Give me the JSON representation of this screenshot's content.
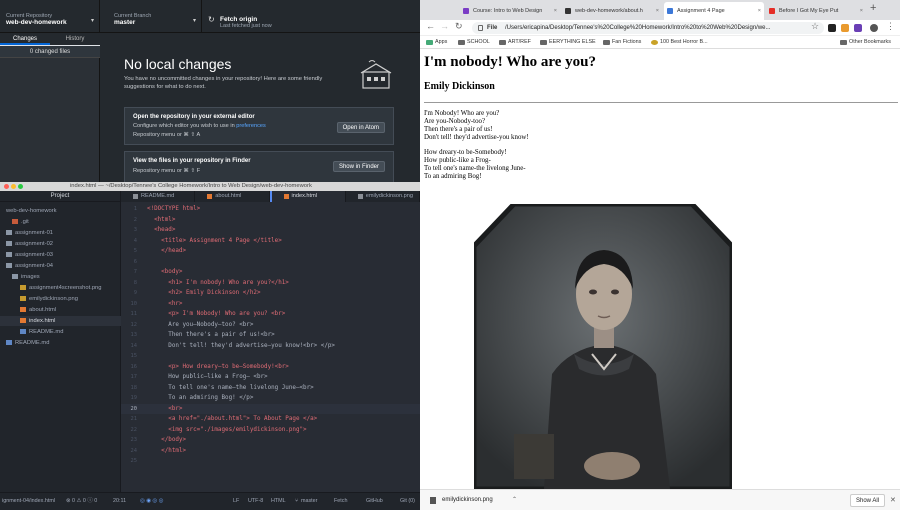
{
  "github": {
    "repo_caption": "Current Repository",
    "repo_name": "web-dev-homework",
    "branch_caption": "Current Branch",
    "branch_name": "master",
    "fetch_title": "Fetch origin",
    "fetch_sub": "Last fetched just now",
    "tabs": [
      "Changes",
      "History"
    ],
    "changed_count": "0 changed files",
    "empty_title": "No local changes",
    "empty_text": "You have no uncommitted changes in your repository! Here are some friendly suggestions for what to do next.",
    "card1_title": "Open the repository in your external editor",
    "card1_text_a": "Configure which editor you wish to use in ",
    "card1_link": "preferences",
    "card1_hint": "Repository menu or  ⌘  ⇧  A",
    "card1_button": "Open in Atom",
    "card2_title": "View the files in your repository in Finder",
    "card2_hint": "Repository menu or  ⌘  ⇧  F",
    "card2_button": "Show in Finder"
  },
  "atom": {
    "window_title": "index.html — ~/Desktop/Tennee's College Homework/Intro to Web Design/web-dev-homework",
    "tree_header": "Project",
    "tree": [
      {
        "label": "web-dev-homework",
        "kind": "root"
      },
      {
        "label": ".git",
        "kind": "git"
      },
      {
        "label": "assignment-01",
        "kind": "folder"
      },
      {
        "label": "assignment-02",
        "kind": "folder"
      },
      {
        "label": "assignment-03",
        "kind": "folder"
      },
      {
        "label": "assignment-04",
        "kind": "folder-open"
      },
      {
        "label": "images",
        "kind": "folder-open"
      },
      {
        "label": "assignment4screenshot.png",
        "kind": "image"
      },
      {
        "label": "emilydickinson.png",
        "kind": "image"
      },
      {
        "label": "about.html",
        "kind": "html"
      },
      {
        "label": "index.html",
        "kind": "html-selected"
      },
      {
        "label": "README.md",
        "kind": "md"
      },
      {
        "label": "README.md",
        "kind": "md"
      }
    ],
    "tabs": [
      "README.md",
      "about.html",
      "index.html",
      "emilydickinson.png"
    ],
    "code": [
      "<!DOCTYPE html>",
      "  <html>",
      "  <head>",
      "    <title> Assignment 4 Page </title>",
      "    </head>",
      "",
      "    <body>",
      "      <h1> I'm nobody! Who are you?</h1>",
      "      <h2> Emily Dickinson </h2>",
      "      <hr>",
      "      <p> I'm Nobody! Who are you? <br>",
      "      Are you—Nobody—too? <br>",
      "      Then there's a pair of us!<br>",
      "      Don't tell! they'd advertise—you know!<br> </p>",
      "",
      "      <p> How dreary—to be—Somebody!<br>",
      "      How public—like a Frog— <br>",
      "      To tell one's name—the livelong June—<br>",
      "      To an admiring Bog! </p>",
      "      <br>",
      "      <a href=\"./about.html\"> To About Page </a>",
      "      <img src=\"./images/emilydickinson.png\">",
      "    </body>",
      "    </html>",
      ""
    ],
    "current_line": 20,
    "status": {
      "path": "ignment-04/index.html",
      "problems": "⊗ 0  ⚠ 0  ⓘ 0",
      "cursor": "20:11",
      "eol": "LF",
      "encoding": "UTF-8",
      "grammar": "HTML",
      "branch": "master",
      "fetch": "Fetch",
      "github": "GitHub",
      "git": "Git (0)"
    }
  },
  "chrome": {
    "tabs": [
      {
        "title": "Course: Intro to Web Design",
        "color": "#7a3cc5"
      },
      {
        "title": "web-dev-homework/about.h",
        "color": "#333333"
      },
      {
        "title": "Assignment 4 Page",
        "color": "#3c78d8"
      },
      {
        "title": "Before I Got My Eye Put",
        "color": "#e52d27"
      }
    ],
    "url_label": "File",
    "url": "/Users/ericapina/Desktop/Tennee's%20College%20Homework/Intro%20to%20Web%20Design/we...",
    "bookmarks": [
      "Apps",
      "SCHOOL",
      "ART/REF",
      "EERYTHING ELSE",
      "Fan Fictions",
      "100 Best Horror B...",
      "Other Bookmarks"
    ],
    "download_file": "emilydickinson.png",
    "download_show_all": "Show All"
  },
  "webpage": {
    "h1": "I'm nobody! Who are you?",
    "h2": "Emily Dickinson",
    "stanza1": [
      "I'm Nobody! Who are you?",
      "Are you-Nobody-too?",
      "Then there's a pair of us!",
      "Don't tell! they'd advertise-you know!"
    ],
    "stanza2": [
      "How dreary-to be-Somebody!",
      "How public-like a Frog-",
      "To tell one's name-the livelong June-",
      "To an admiring Bog!"
    ]
  }
}
